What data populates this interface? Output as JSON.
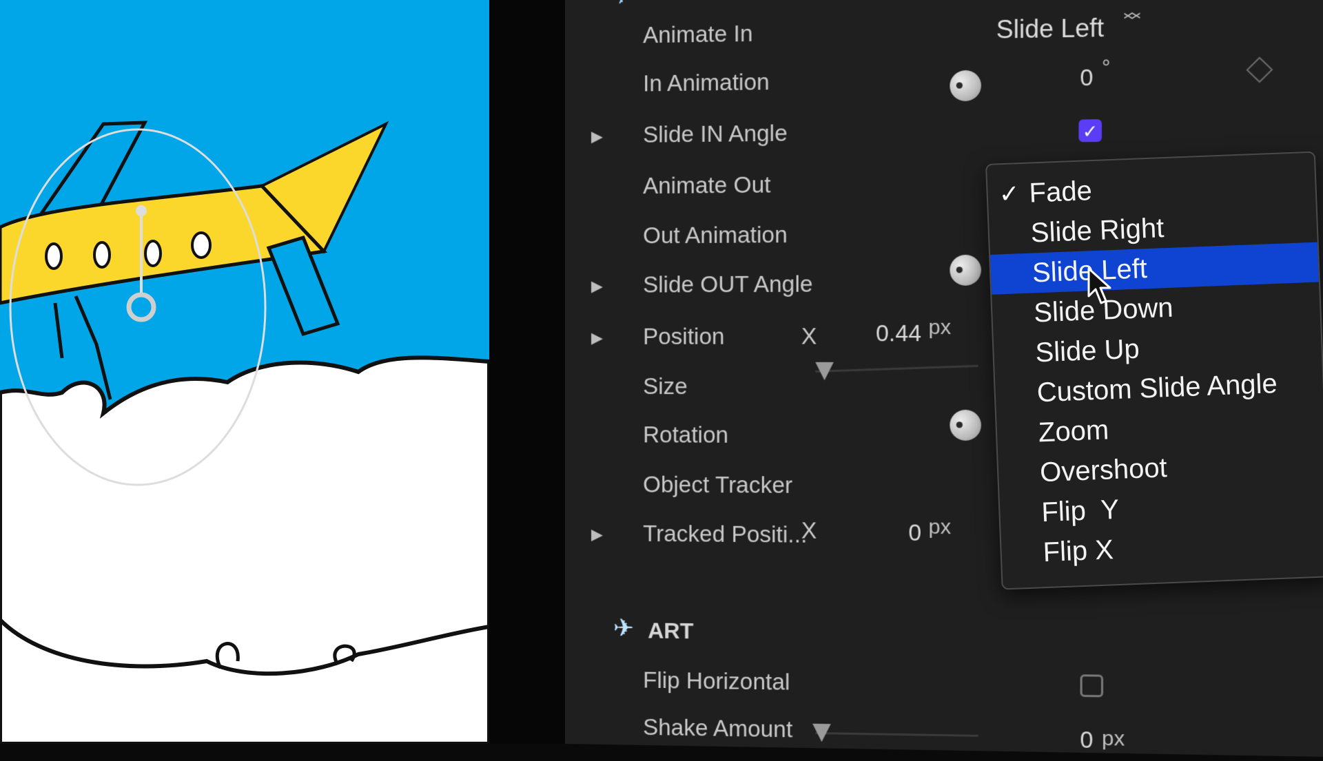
{
  "inspector": {
    "rows": [
      {
        "label": "Animate In",
        "type": "popup",
        "value": "Slide Left"
      },
      {
        "label": "In Animation",
        "type": "angle",
        "value": "0",
        "unit": "°"
      },
      {
        "label": "Slide IN Angle",
        "type": "checkbox",
        "checked": true
      },
      {
        "label": "Animate Out"
      },
      {
        "label": "Out Animation"
      },
      {
        "label": "Slide OUT Angle",
        "type": "angle"
      },
      {
        "label": "Position",
        "axis": "X",
        "value": "0.44",
        "unit": "px"
      },
      {
        "label": "Size",
        "type": "slider"
      },
      {
        "label": "Rotation",
        "type": "angle"
      },
      {
        "label": "Object Tracker"
      },
      {
        "label": "Tracked Positi...",
        "axis": "X",
        "value": "0",
        "unit": "px"
      }
    ],
    "art_section": {
      "title": "ART",
      "icon": "airplane-icon",
      "rows": [
        {
          "label": "Flip Horizontal",
          "type": "checkbox",
          "checked": false
        },
        {
          "label": "Shake Amount",
          "value": "0",
          "unit": "px"
        }
      ]
    }
  },
  "menu": {
    "items": [
      {
        "label": "Fade",
        "checked": true
      },
      {
        "label": "Slide Right"
      },
      {
        "label": "Slide Left",
        "highlighted": true
      },
      {
        "label": "Slide Down"
      },
      {
        "label": "Slide Up"
      },
      {
        "label": "Custom Slide Angle"
      },
      {
        "label": "Zoom"
      },
      {
        "label": "Overshoot"
      },
      {
        "label": "Flip  Y"
      },
      {
        "label": "Flip X"
      }
    ],
    "check_glyph": "✓",
    "highlight_color": "#0f44d2"
  },
  "colors": {
    "canvas_bg": "#01a6e8",
    "plane_body": "#fcd72b",
    "cloud": "#ffffff",
    "checkbox_on": "#5b3df5"
  }
}
